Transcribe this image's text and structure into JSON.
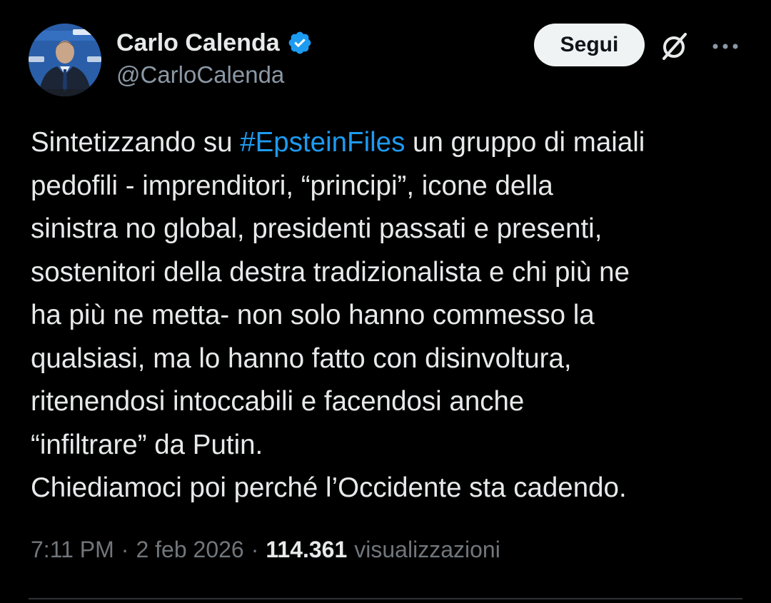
{
  "author": {
    "display_name": "Carlo Calenda",
    "handle": "@CarloCalenda",
    "verified_icon": "verified-badge-icon",
    "avatar_icon": "profile-photo"
  },
  "actions": {
    "follow_label": "Segui",
    "grok_icon": "grok-icon",
    "more_icon": "more-options-icon"
  },
  "text": {
    "line1_before": "Sintetizzando su ",
    "hashtag": "#EpsteinFiles",
    "line1_after": " un gruppo di maiali",
    "lines": [
      "pedofili - imprenditori, “principi”, icone della",
      "sinistra no global, presidenti passati e presenti,",
      "sostenitori della destra tradizionalista e chi più ne",
      "ha più ne metta- non solo hanno commesso la",
      "qualsiasi, ma lo hanno fatto con disinvoltura,",
      "ritenendosi intoccabili e facendosi anche",
      "“infiltrare” da Putin.",
      "Chiediamoci poi perché l’Occidente sta cadendo."
    ]
  },
  "meta": {
    "time": "7:11 PM",
    "separator": "·",
    "date": "2 feb 2026",
    "views_count": "114.361",
    "views_label": "visualizzazioni"
  },
  "colors": {
    "background": "#000000",
    "text_primary": "#e7e9ea",
    "text_secondary": "#71767b",
    "link": "#1d9bf0",
    "verified": "#1d9bf0",
    "button_bg": "#eff3f4",
    "button_text": "#0f1419"
  }
}
